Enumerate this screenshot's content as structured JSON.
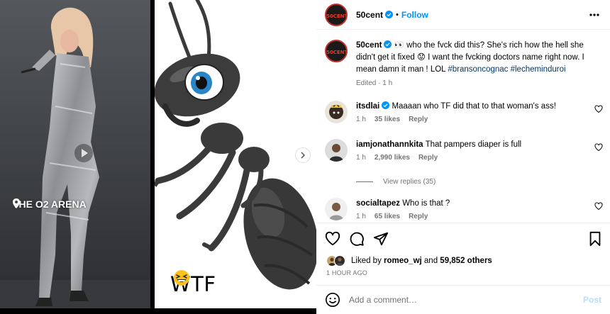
{
  "media": {
    "location_label": "THE O2 ARENA",
    "caption_text": "WTF",
    "caption_emoji": "grinning-squinting-face-emoji"
  },
  "header": {
    "avatar_text": "50CENT",
    "username": "50cent",
    "separator": "•",
    "follow_label": "Follow",
    "more_icon": "more-horizontal-icon"
  },
  "caption": {
    "username": "50cent",
    "text_before_emoji": " 👀 who the fvck did this? She's rich how the hell she didn't get it fixed ",
    "emoji": "😟",
    "text_after_emoji": " I want the fvcking doctors name right now. I mean damn it man ! LOL ",
    "hashtags": [
      "#bransoncognac",
      "#lecheminduroi"
    ],
    "edited": "Edited",
    "time": "1 h"
  },
  "comments": [
    {
      "username": "itsdlai",
      "verified": true,
      "text": "Maaaan who TF did that to that woman's ass!",
      "time": "1 h",
      "likes": "35 likes",
      "reply": "Reply"
    },
    {
      "username": "iamjonathannkita",
      "verified": false,
      "text": "That pampers diaper is full",
      "time": "1 h",
      "likes": "2,990 likes",
      "reply": "Reply"
    },
    {
      "username": "socialtapez",
      "verified": false,
      "text": "Who is that ?",
      "time": "1 h",
      "likes": "65 likes",
      "reply": "Reply"
    }
  ],
  "view_replies": "View replies (35)",
  "likes": {
    "prefix": "Liked by ",
    "user": "romeo_wj",
    "middle": " and ",
    "count": "59,852 others"
  },
  "post_time": "1 HOUR AGO",
  "comment_input": {
    "placeholder": "Add a comment…",
    "value": "",
    "post_label": "Post"
  },
  "colors": {
    "link_blue": "#0095f6",
    "hashtag_blue": "#00376b",
    "muted": "#737373",
    "post_disabled": "#b2dffc"
  }
}
